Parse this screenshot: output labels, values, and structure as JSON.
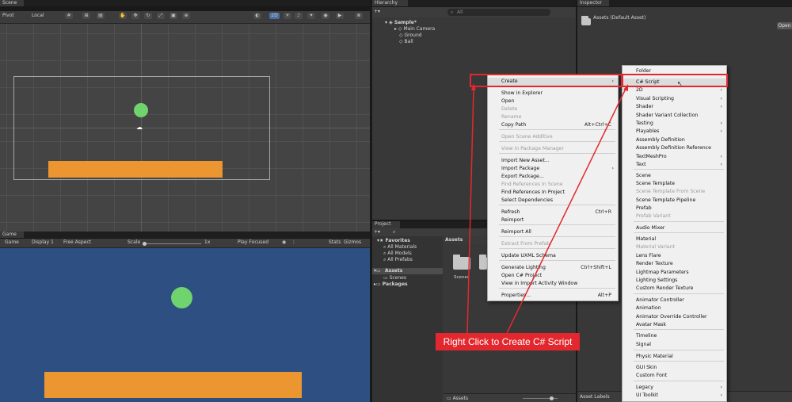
{
  "scene_panel": {
    "tab_label": "Scene",
    "toolbar": {
      "pivot": "Pivot",
      "local": "Local",
      "mode_2d": "2D"
    }
  },
  "game_panel": {
    "tab_label": "Game",
    "toolbar": {
      "display": "Display 1",
      "aspect": "Free Aspect",
      "scale_label": "Scale",
      "scale_value": "1x",
      "play_mode": "Play Focused",
      "stats": "Stats",
      "gizmos": "Gizmos"
    }
  },
  "hierarchy": {
    "tab_label": "Hierarchy",
    "search_placeholder": "All",
    "scene_name": "Sample*",
    "items": [
      "Main Camera",
      "Ground",
      "Ball"
    ]
  },
  "inspector": {
    "tab_label": "Inspector",
    "title": "Assets (Default Asset)",
    "open_button": "Open",
    "footer": "Asset Labels"
  },
  "project": {
    "tab_label": "Project",
    "favorites": {
      "label": "Favorites",
      "items": [
        "All Materials",
        "All Models",
        "All Prefabs"
      ]
    },
    "assets": {
      "label": "Assets",
      "children": [
        "Scenes"
      ]
    },
    "packages": "Packages",
    "content_header": "Assets",
    "folder_label": "Scenes",
    "footer_path": "Assets"
  },
  "context_menu": {
    "items": [
      {
        "label": "Create",
        "shortcut": "",
        "submenu": true,
        "disabled": false
      },
      {
        "label": "Show in Explorer",
        "shortcut": "",
        "submenu": false,
        "disabled": false
      },
      {
        "label": "Open",
        "shortcut": "",
        "submenu": false,
        "disabled": false
      },
      {
        "label": "Delete",
        "shortcut": "",
        "submenu": false,
        "disabled": true
      },
      {
        "label": "Rename",
        "shortcut": "",
        "submenu": false,
        "disabled": true
      },
      {
        "label": "Copy Path",
        "shortcut": "Alt+Ctrl+C",
        "submenu": false,
        "disabled": false
      },
      {
        "label": "Open Scene Additive",
        "shortcut": "",
        "submenu": false,
        "disabled": true
      },
      {
        "label": "View in Package Manager",
        "shortcut": "",
        "submenu": false,
        "disabled": true
      },
      {
        "label": "Import New Asset...",
        "shortcut": "",
        "submenu": false,
        "disabled": false
      },
      {
        "label": "Import Package",
        "shortcut": "",
        "submenu": true,
        "disabled": false
      },
      {
        "label": "Export Package...",
        "shortcut": "",
        "submenu": false,
        "disabled": false
      },
      {
        "label": "Find References In Scene",
        "shortcut": "",
        "submenu": false,
        "disabled": true
      },
      {
        "label": "Find References In Project",
        "shortcut": "",
        "submenu": false,
        "disabled": false
      },
      {
        "label": "Select Dependencies",
        "shortcut": "",
        "submenu": false,
        "disabled": false
      },
      {
        "label": "Refresh",
        "shortcut": "Ctrl+R",
        "submenu": false,
        "disabled": false
      },
      {
        "label": "Reimport",
        "shortcut": "",
        "submenu": false,
        "disabled": false
      },
      {
        "label": "Reimport All",
        "shortcut": "",
        "submenu": false,
        "disabled": false
      },
      {
        "label": "Extract From Prefab",
        "shortcut": "",
        "submenu": false,
        "disabled": true
      },
      {
        "label": "Update UXML Schema",
        "shortcut": "",
        "submenu": false,
        "disabled": false
      },
      {
        "label": "Generate Lighting",
        "shortcut": "Ctrl+Shift+L",
        "submenu": false,
        "disabled": false
      },
      {
        "label": "Open C# Project",
        "shortcut": "",
        "submenu": false,
        "disabled": false
      },
      {
        "label": "View in Import Activity Window",
        "shortcut": "",
        "submenu": false,
        "disabled": false
      },
      {
        "label": "Properties...",
        "shortcut": "Alt+P",
        "submenu": false,
        "disabled": false
      }
    ]
  },
  "create_submenu": {
    "items": [
      {
        "label": "Folder",
        "submenu": false,
        "disabled": false
      },
      {
        "label": "C# Script",
        "submenu": false,
        "disabled": false
      },
      {
        "label": "2D",
        "submenu": true,
        "disabled": false
      },
      {
        "label": "Visual Scripting",
        "submenu": true,
        "disabled": false
      },
      {
        "label": "Shader",
        "submenu": true,
        "disabled": false
      },
      {
        "label": "Shader Variant Collection",
        "submenu": false,
        "disabled": false
      },
      {
        "label": "Testing",
        "submenu": true,
        "disabled": false
      },
      {
        "label": "Playables",
        "submenu": true,
        "disabled": false
      },
      {
        "label": "Assembly Definition",
        "submenu": false,
        "disabled": false
      },
      {
        "label": "Assembly Definition Reference",
        "submenu": false,
        "disabled": false
      },
      {
        "label": "TextMeshPro",
        "submenu": true,
        "disabled": false
      },
      {
        "label": "Text",
        "submenu": true,
        "disabled": false
      },
      {
        "label": "Scene",
        "submenu": false,
        "disabled": false
      },
      {
        "label": "Scene Template",
        "submenu": false,
        "disabled": false
      },
      {
        "label": "Scene Template From Scene",
        "submenu": false,
        "disabled": true
      },
      {
        "label": "Scene Template Pipeline",
        "submenu": false,
        "disabled": false
      },
      {
        "label": "Prefab",
        "submenu": false,
        "disabled": false
      },
      {
        "label": "Prefab Variant",
        "submenu": false,
        "disabled": true
      },
      {
        "label": "Audio Mixer",
        "submenu": false,
        "disabled": false
      },
      {
        "label": "Material",
        "submenu": false,
        "disabled": false
      },
      {
        "label": "Material Variant",
        "submenu": false,
        "disabled": true
      },
      {
        "label": "Lens Flare",
        "submenu": false,
        "disabled": false
      },
      {
        "label": "Render Texture",
        "submenu": false,
        "disabled": false
      },
      {
        "label": "Lightmap Parameters",
        "submenu": false,
        "disabled": false
      },
      {
        "label": "Lighting Settings",
        "submenu": false,
        "disabled": false
      },
      {
        "label": "Custom Render Texture",
        "submenu": false,
        "disabled": false
      },
      {
        "label": "Animator Controller",
        "submenu": false,
        "disabled": false
      },
      {
        "label": "Animation",
        "submenu": false,
        "disabled": false
      },
      {
        "label": "Animator Override Controller",
        "submenu": false,
        "disabled": false
      },
      {
        "label": "Avatar Mask",
        "submenu": false,
        "disabled": false
      },
      {
        "label": "Timeline",
        "submenu": false,
        "disabled": false
      },
      {
        "label": "Signal",
        "submenu": false,
        "disabled": false
      },
      {
        "label": "Physic Material",
        "submenu": false,
        "disabled": false
      },
      {
        "label": "GUI Skin",
        "submenu": false,
        "disabled": false
      },
      {
        "label": "Custom Font",
        "submenu": false,
        "disabled": false
      },
      {
        "label": "Legacy",
        "submenu": true,
        "disabled": false
      },
      {
        "label": "UI Toolkit",
        "submenu": true,
        "disabled": false
      }
    ]
  },
  "annotation": {
    "callout": "Right Click to Create C# Script"
  },
  "colors": {
    "ball": "#6fd36e",
    "platform": "#eb9630",
    "game_background": "#2d4f82",
    "annotation_red": "#e2282e",
    "menu_background": "#f0f0f0"
  }
}
